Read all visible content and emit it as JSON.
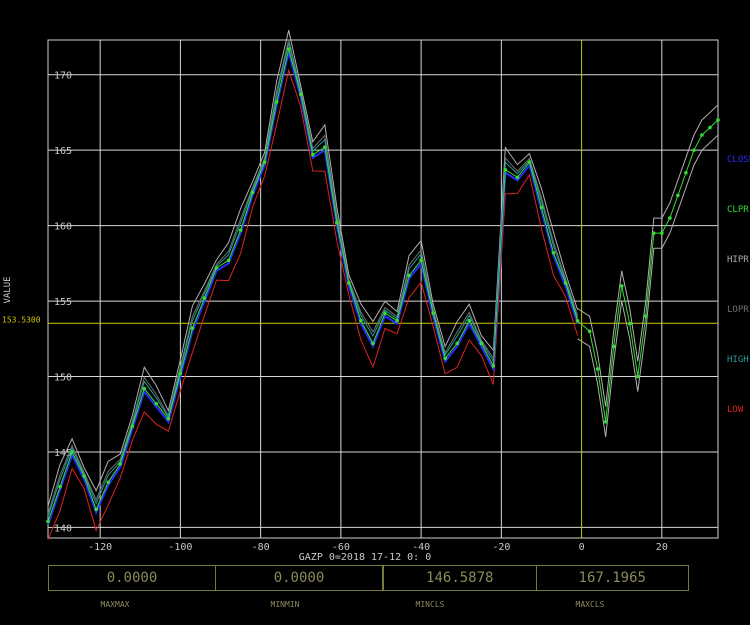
{
  "chart_data": {
    "type": "line",
    "ylabel": "VALUE",
    "xlim": [
      -133,
      34
    ],
    "ylim": [
      139.3,
      172.3
    ],
    "x_ticks": [
      -120,
      -100,
      -80,
      -60,
      -40,
      -20,
      0,
      20
    ],
    "y_ticks": [
      140,
      145,
      150,
      155,
      160,
      165,
      170
    ],
    "grid": true,
    "reference_line": {
      "value": "153.5300",
      "color": "#c8c800"
    },
    "vertical_marker_x": 0,
    "center_label": "GAZP    0=2018  17-12   0: 0",
    "legend": [
      {
        "name": "CLOSE",
        "color": "#2a2aff"
      },
      {
        "name": "CLPR",
        "color": "#33dd33"
      },
      {
        "name": "HIPR",
        "color": "#b0b0b0"
      },
      {
        "name": "LOPR",
        "color": "#707070"
      },
      {
        "name": "HIGH",
        "color": "#2a9a9a"
      },
      {
        "name": "LOW",
        "color": "#dd2222"
      }
    ],
    "close_x": [
      -133,
      -130,
      -127,
      -124,
      -121,
      -118,
      -115,
      -112,
      -109,
      -106,
      -103,
      -100,
      -97,
      -94,
      -91,
      -88,
      -85,
      -82,
      -79,
      -76,
      -73,
      -70,
      -67,
      -64,
      -61,
      -58,
      -55,
      -52,
      -49,
      -46,
      -43,
      -40,
      -37,
      -34,
      -31,
      -28,
      -25,
      -22,
      -19,
      -16,
      -13,
      -10,
      -7,
      -4,
      -1
    ],
    "close_y": [
      140.2,
      142.5,
      144.8,
      143.2,
      141.0,
      142.8,
      144.0,
      146.5,
      149.0,
      148.0,
      147.0,
      150.0,
      153.0,
      155.0,
      157.0,
      157.5,
      159.5,
      162.0,
      164.0,
      168.0,
      171.5,
      168.5,
      164.5,
      165.0,
      160.0,
      156.0,
      153.5,
      152.0,
      154.0,
      153.5,
      156.5,
      157.5,
      154.0,
      151.0,
      152.0,
      153.5,
      152.0,
      150.5,
      163.5,
      163.0,
      164.0,
      161.0,
      158.0,
      156.0,
      153.5
    ],
    "forecast_x": [
      2,
      4,
      6,
      8,
      10,
      12,
      14,
      16,
      18,
      20,
      22,
      24,
      26,
      28,
      30,
      32,
      34
    ],
    "forecast_y": [
      153.0,
      150.5,
      147.0,
      152.0,
      156.0,
      153.5,
      150.0,
      154.0,
      159.5,
      159.5,
      160.5,
      162.0,
      163.5,
      165.0,
      166.0,
      166.5,
      167.0
    ],
    "summary": {
      "MAXMAX": "0.0000",
      "MINMIN": "0.0000",
      "MINCLS": "146.5878",
      "MAXCLS": "167.1965"
    }
  }
}
